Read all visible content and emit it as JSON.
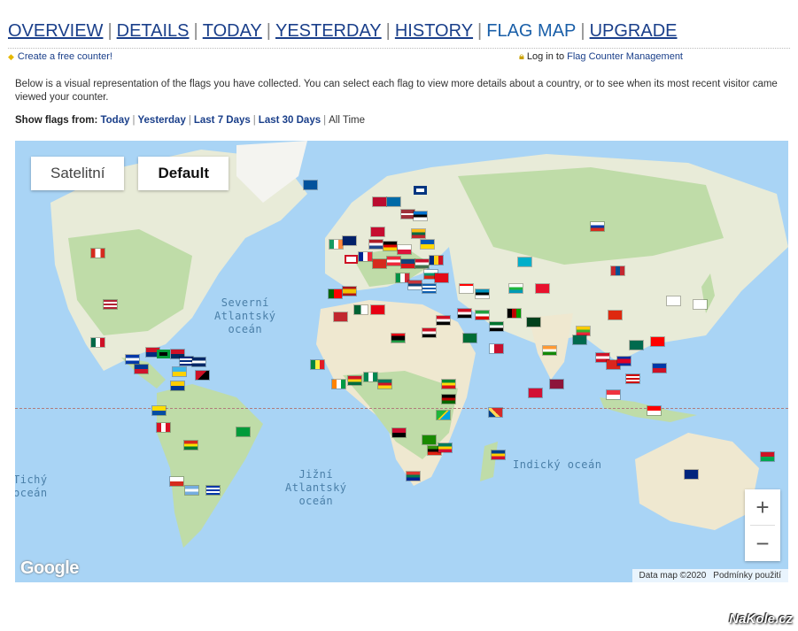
{
  "nav": {
    "overview": "OVERVIEW",
    "details": "DETAILS",
    "today": "TODAY",
    "yesterday": "YESTERDAY",
    "history": "HISTORY",
    "flagmap": "FLAG MAP",
    "upgrade": "UPGRADE",
    "sep": "|"
  },
  "topline": {
    "create": "Create a free counter!",
    "login_prefix": "Log in to",
    "login_link": "Flag Counter Management"
  },
  "description": "Below is a visual representation of the flags you have collected. You can select each flag to view more details about a country, or to see when its most recent visitor came viewed your counter.",
  "show_flags": {
    "label": "Show flags from:",
    "today": "Today",
    "yesterday": "Yesterday",
    "last7": "Last 7 Days",
    "last30": "Last 30 Days",
    "alltime": "All Time",
    "sep": "|"
  },
  "map": {
    "type_satellite": "Satelitní",
    "type_default": "Default",
    "ocean_n_atlantic": "Severní\nAtlantský\noceán",
    "ocean_s_atlantic": "Jižní\nAtlantský\noceán",
    "ocean_indian": "Indický oceán",
    "ocean_pacific_partial": "Tichý\noceán",
    "zoom_in": "+",
    "zoom_out": "−",
    "google": "Google",
    "data": "Data map ©2020",
    "terms": "Podmínky použití"
  },
  "watermark": "NaKole.cz",
  "colors": {
    "link": "#1a3f8a",
    "water": "#a9d4f5",
    "land": "#e8ebd8",
    "green_land": "#bfdca8"
  }
}
